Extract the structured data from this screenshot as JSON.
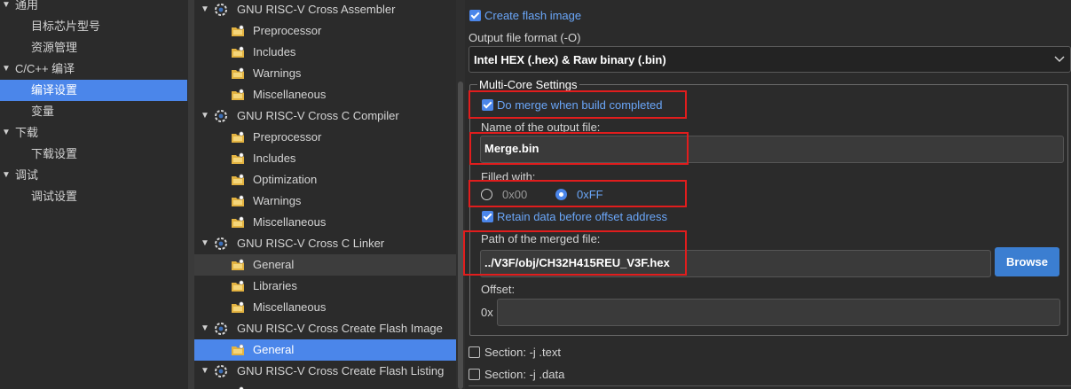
{
  "left_nav": {
    "items": [
      {
        "label": "通用"
      },
      {
        "label": "目标芯片型号"
      },
      {
        "label": "资源管理"
      },
      {
        "label": "C/C++ 编译"
      },
      {
        "label": "编译设置"
      },
      {
        "label": "变量"
      },
      {
        "label": "下载"
      },
      {
        "label": "下载设置"
      },
      {
        "label": "调试"
      },
      {
        "label": "调试设置"
      }
    ]
  },
  "tree": {
    "items": [
      {
        "label": "GNU RISC-V Cross Assembler"
      },
      {
        "label": "Preprocessor"
      },
      {
        "label": "Includes"
      },
      {
        "label": "Warnings"
      },
      {
        "label": "Miscellaneous"
      },
      {
        "label": "GNU RISC-V Cross C Compiler"
      },
      {
        "label": "Preprocessor"
      },
      {
        "label": "Includes"
      },
      {
        "label": "Optimization"
      },
      {
        "label": "Warnings"
      },
      {
        "label": "Miscellaneous"
      },
      {
        "label": "GNU RISC-V Cross C Linker"
      },
      {
        "label": "General"
      },
      {
        "label": "Libraries"
      },
      {
        "label": "Miscellaneous"
      },
      {
        "label": "GNU RISC-V Cross Create Flash Image"
      },
      {
        "label": "General"
      },
      {
        "label": "GNU RISC-V Cross Create Flash Listing"
      }
    ]
  },
  "settings": {
    "create_flash_image": "Create flash image",
    "output_format_label": "Output file format (-O)",
    "output_format_value": "Intel HEX (.hex) & Raw binary (.bin)",
    "multicore_group": "Multi-Core Settings",
    "merge_label": "Do merge when build completed",
    "output_name_label": "Name of the output file:",
    "output_name_value": "Merge.bin",
    "filled_label": "Filled with:",
    "fill_option_1": "0x00",
    "fill_option_2": "0xFF",
    "retain_label": "Retain data before offset address",
    "merged_path_label": "Path of the merged file:",
    "merged_path_value": "../V3F/obj/CH32H415REU_V3F.hex",
    "browse_label": "Browse",
    "offset_label": "Offset:",
    "offset_prefix": "0x",
    "section_text": "Section: -j .text",
    "section_data": "Section: -j .data"
  },
  "colors": {
    "accent": "#4b86ea",
    "highlight": "#e11d1d",
    "link_text": "#6aa6f8"
  }
}
